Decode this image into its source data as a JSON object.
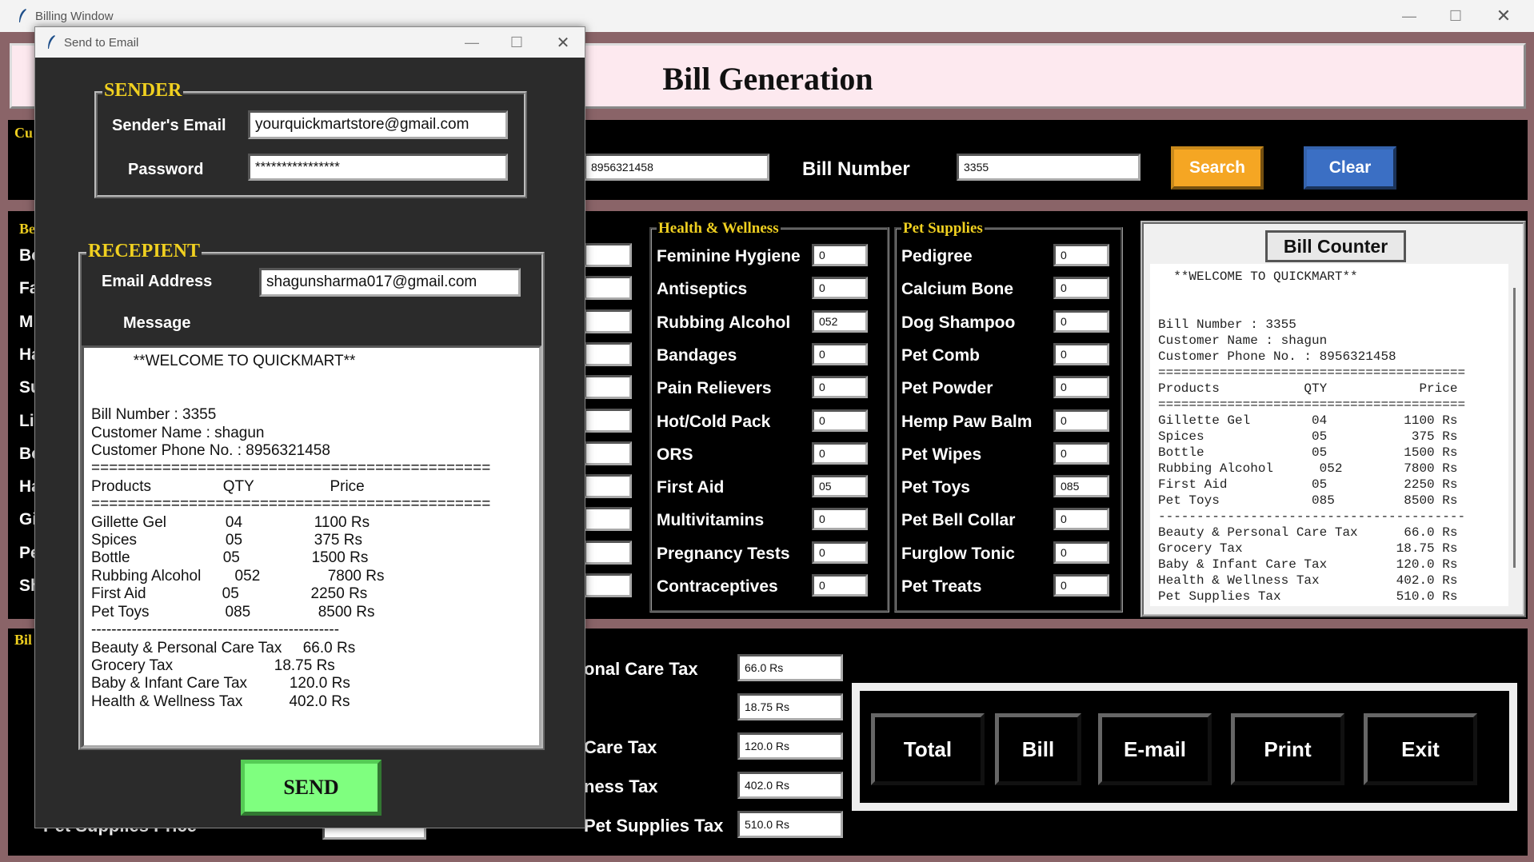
{
  "main_window": {
    "title": "Billing Window",
    "header_title": "Bill Generation",
    "customer_frame_label": "Cu",
    "phone_value": "8956321458",
    "bill_number_label": "Bill Number",
    "bill_number_value": "3355",
    "search_label": "Search",
    "clear_label": "Clear",
    "left_frame_label": "Be",
    "left_item_fragments": [
      "Bo",
      "Fa",
      "M",
      "Ha",
      "Su",
      "Lip",
      "Bo",
      "Ha",
      "Gi",
      "Pe",
      "Sh"
    ],
    "health_title": "Health & Wellness",
    "health_items": [
      {
        "label": "Feminine Hygiene",
        "qty": "0"
      },
      {
        "label": "Antiseptics",
        "qty": "0"
      },
      {
        "label": "Rubbing Alcohol",
        "qty": "052"
      },
      {
        "label": "Bandages",
        "qty": "0"
      },
      {
        "label": "Pain Relievers",
        "qty": "0"
      },
      {
        "label": "Hot/Cold Pack",
        "qty": "0"
      },
      {
        "label": "ORS",
        "qty": "0"
      },
      {
        "label": "First Aid",
        "qty": "05"
      },
      {
        "label": "Multivitamins",
        "qty": "0"
      },
      {
        "label": "Pregnancy Tests",
        "qty": "0"
      },
      {
        "label": "Contraceptives",
        "qty": "0"
      }
    ],
    "pet_title": "Pet Supplies",
    "pet_items": [
      {
        "label": "Pedigree",
        "qty": "0"
      },
      {
        "label": "Calcium Bone",
        "qty": "0"
      },
      {
        "label": "Dog Shampoo",
        "qty": "0"
      },
      {
        "label": "Pet Comb",
        "qty": "0"
      },
      {
        "label": "Pet Powder",
        "qty": "0"
      },
      {
        "label": "Hemp Paw Balm",
        "qty": "0"
      },
      {
        "label": "Pet Wipes",
        "qty": "0"
      },
      {
        "label": "Pet Toys",
        "qty": "085"
      },
      {
        "label": "Pet Bell Collar",
        "qty": "0"
      },
      {
        "label": "Furglow Tonic",
        "qty": "0"
      },
      {
        "label": "Pet Treats",
        "qty": "0"
      }
    ],
    "bill_counter_title": "Bill Counter",
    "bill_counter_text": "  **WELCOME TO QUICKMART**\n\n\nBill Number : 3355\nCustomer Name : shagun\nCustomer Phone No. : 8956321458\n========================================\nProducts           QTY            Price\n========================================\nGillette Gel        04          1100 Rs\nSpices              05           375 Rs\nBottle              05          1500 Rs\nRubbing Alcohol      052        7800 Rs\nFirst Aid           05          2250 Rs\nPet Toys            085         8500 Rs\n----------------------------------------\nBeauty & Personal Care Tax      66.0 Rs\nGrocery Tax                    18.75 Rs\nBaby & Infant Care Tax         120.0 Rs\nHealth & Wellness Tax          402.0 Rs\nPet Supplies Tax               510.0 Rs",
    "bill_menu_label": "Bil",
    "tax_labels": [
      "onal Care Tax",
      "",
      "Care Tax",
      "ness Tax",
      "Pet Supplies Tax"
    ],
    "tax_values": [
      "66.0 Rs",
      "18.75 Rs",
      "120.0 Rs",
      "402.0 Rs",
      "510.0 Rs"
    ],
    "pet_supplies_price_label": "Pet Supplies Price",
    "action_buttons": [
      "Total",
      "Bill",
      "E-mail",
      "Print",
      "Exit"
    ]
  },
  "dialog": {
    "title": "Send to Email",
    "sender_title": "SENDER",
    "sender_email_label": "Sender's Email",
    "sender_email_value": "yourquickmartstore@gmail.com",
    "password_label": "Password",
    "password_value": "****************",
    "recipient_title": "RECEPIENT",
    "email_address_label": "Email Address",
    "email_address_value": "shagunsharma017@gmail.com",
    "message_label": "Message",
    "message_text": "          **WELCOME TO QUICKMART**\n\n\nBill Number : 3355\nCustomer Name : shagun\nCustomer Phone No. : 8956321458\n=============================================\nProducts                 QTY                  Price\n=============================================\nGillette Gel              04                 1100 Rs\nSpices                     05                 375 Rs\nBottle                      05                 1500 Rs\nRubbing Alcohol        052                7800 Rs\nFirst Aid                  05                 2250 Rs\nPet Toys                  085                8500 Rs\n-------------------------------------------------\nBeauty & Personal Care Tax     66.0 Rs\nGrocery Tax                        18.75 Rs\nBaby & Infant Care Tax          120.0 Rs\nHealth & Wellness Tax           402.0 Rs",
    "send_label": "SEND"
  }
}
